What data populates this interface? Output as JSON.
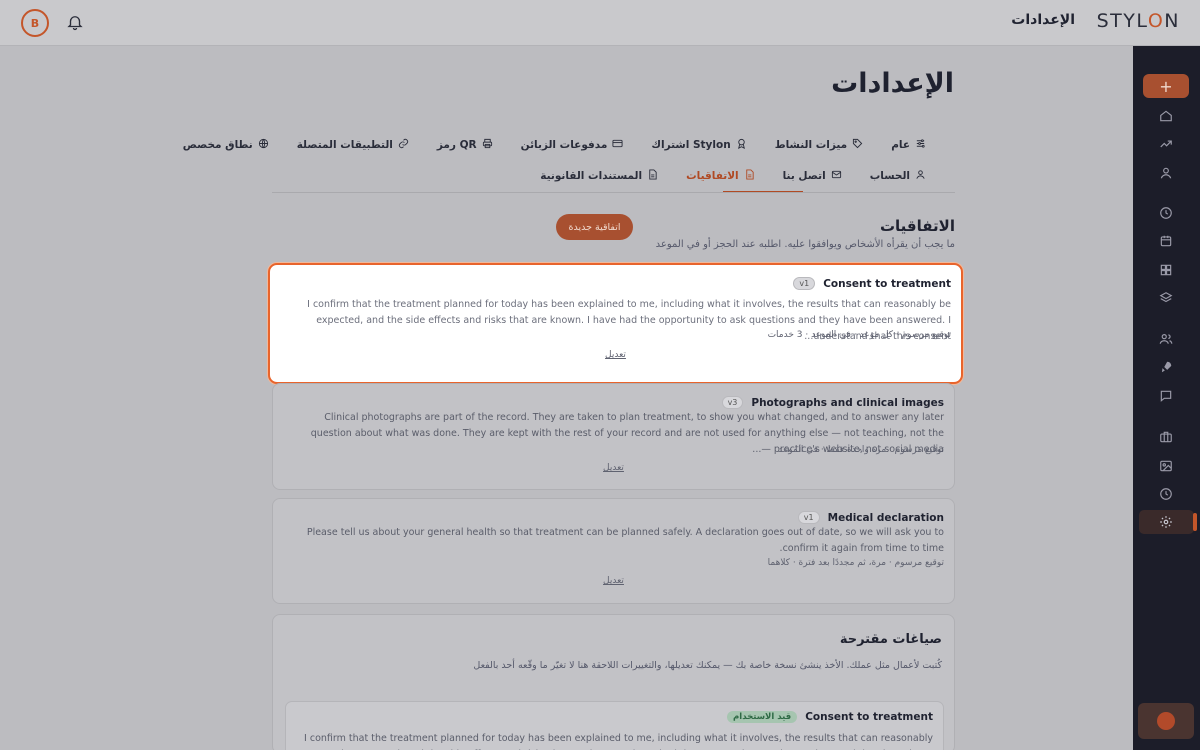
{
  "header": {
    "avatar_initial": "B",
    "title": "الإعدادات",
    "logo_text_a": "STYL",
    "logo_text_o": "O",
    "logo_text_b": "N"
  },
  "sidebar": {
    "add_label": "+",
    "icons": [
      "home-icon",
      "trend-icon",
      "user-icon",
      "clock-icon",
      "calendar-icon",
      "grid-icon",
      "layers-icon",
      "users-icon",
      "rocket-icon",
      "chat-icon",
      "briefcase-icon",
      "image-icon",
      "history-icon",
      "gear-icon"
    ]
  },
  "page": {
    "title": "الإعدادات"
  },
  "tabs_row1": [
    {
      "label": "عام",
      "icon": "sliders-icon"
    },
    {
      "label": "ميزات النشاط",
      "icon": "tag-icon"
    },
    {
      "label": "اشتراك Stylon",
      "icon": "award-icon"
    },
    {
      "label": "مدفوعات الزبائن",
      "icon": "card-icon"
    },
    {
      "label": "رمز QR",
      "icon": "printer-icon"
    },
    {
      "label": "التطبيقات المتصلة",
      "icon": "link-icon"
    },
    {
      "label": "نطاق مخصص",
      "icon": "globe-icon"
    }
  ],
  "tabs_row2": [
    {
      "label": "الحساب",
      "icon": "person-icon"
    },
    {
      "label": "اتصل بنا",
      "icon": "mail-icon"
    },
    {
      "label": "الاتفاقيات",
      "icon": "doc-icon",
      "active": true
    },
    {
      "label": "المستندات القانونية",
      "icon": "file-icon"
    }
  ],
  "agreements": {
    "title": "الاتفاقيات",
    "subtitle": "ما يجب أن يقرأه الأشخاص ويوافقوا عليه. اطلبه عند الحجز أو في الموعد",
    "new_button": "اتفاقية جديدة",
    "cards": [
      {
        "title": "Consent to treatment",
        "version": "v1",
        "body": "I confirm that the treatment planned for today has been explained to me, including what it involves, the results that can reasonably be expected, and the side effects and risks that are known. I have had the opportunity to ask questions and they have been answered. I understand that this consent...",
        "meta": "توقيع مرسوم · كل موعد · في الموعد · 3 خدمات",
        "edit": "تعديل"
      },
      {
        "title": "Photographs and clinical images",
        "version": "v3",
        "body": "Clinical photographs are part of the record. They are taken to plan treatment, to show you what changed, and to answer any later question about what was done. They are kept with the rest of your record and are not used for anything else — not teaching, not the practice's website, not social media —...",
        "meta": "توقيع مرسوم · مرة واحدة فقط · في الموعد",
        "edit": "تعديل"
      },
      {
        "title": "Medical declaration",
        "version": "v1",
        "body": "Please tell us about your general health so that treatment can be planned safely. A declaration goes out of date, so we will ask you to confirm it again from time to time.",
        "meta": "توقيع مرسوم · مرة، ثم مجددًا بعد فترة · كلاهما",
        "edit": "تعديل"
      }
    ]
  },
  "suggested": {
    "title": "صياغات مقترحة",
    "subtitle": "كُتبت لأعمال مثل عملك. الأخذ ينشئ نسخة خاصة بك — يمكنك تعديلها، والتغييرات اللاحقة هنا لا تغيّر ما وقّعه أحد بالفعل",
    "card": {
      "title": "Consent to treatment",
      "badge": "قيد الاستخدام",
      "body": "I confirm that the treatment planned for today has been explained to me, including what it involves, the results that can reasonably be expected, and the side effects and risks that are known. I have had the opportunity to ask questions and they have been answered. I understand that this"
    }
  }
}
